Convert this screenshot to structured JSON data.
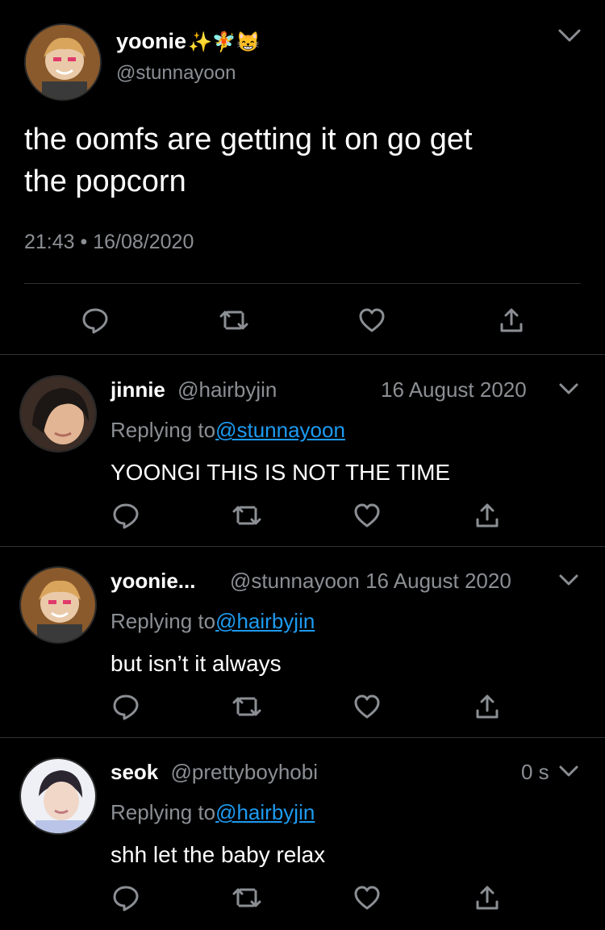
{
  "main_tweet": {
    "display_name": "yoonie",
    "name_emojis": "✨🧚😸",
    "handle": "@stunnayoon",
    "text_line1": "the oomfs are getting it on go get",
    "text_line2": "the popcorn",
    "time": "21:43",
    "dot": "•",
    "date": "16/08/2020"
  },
  "replies": [
    {
      "display_name": "jinnie",
      "handle": "@hairbyjin",
      "time": "16 August 2020",
      "replying_label": "Replying to",
      "replying_to": "@stunnayoon",
      "text": "YOONGI THIS IS NOT THE TIME"
    },
    {
      "display_name": "yoonie...",
      "handle": "@stunnayoon",
      "time": "16 August 2020",
      "replying_label": "Replying to",
      "replying_to": "@hairbyjin",
      "text": "but isn’t it always"
    },
    {
      "display_name": "seok",
      "handle": "@prettyboyhobi",
      "time": "0 s",
      "replying_label": "Replying to",
      "replying_to": "@hairbyjin",
      "text": "shh let the baby relax"
    }
  ],
  "icons": [
    "reply-icon",
    "retweet-icon",
    "like-icon",
    "share-icon",
    "chevron-down-icon"
  ],
  "colors": {
    "background": "#000000",
    "text": "#ffffff",
    "secondary": "#8b8f94",
    "link": "#1d9bf0"
  }
}
